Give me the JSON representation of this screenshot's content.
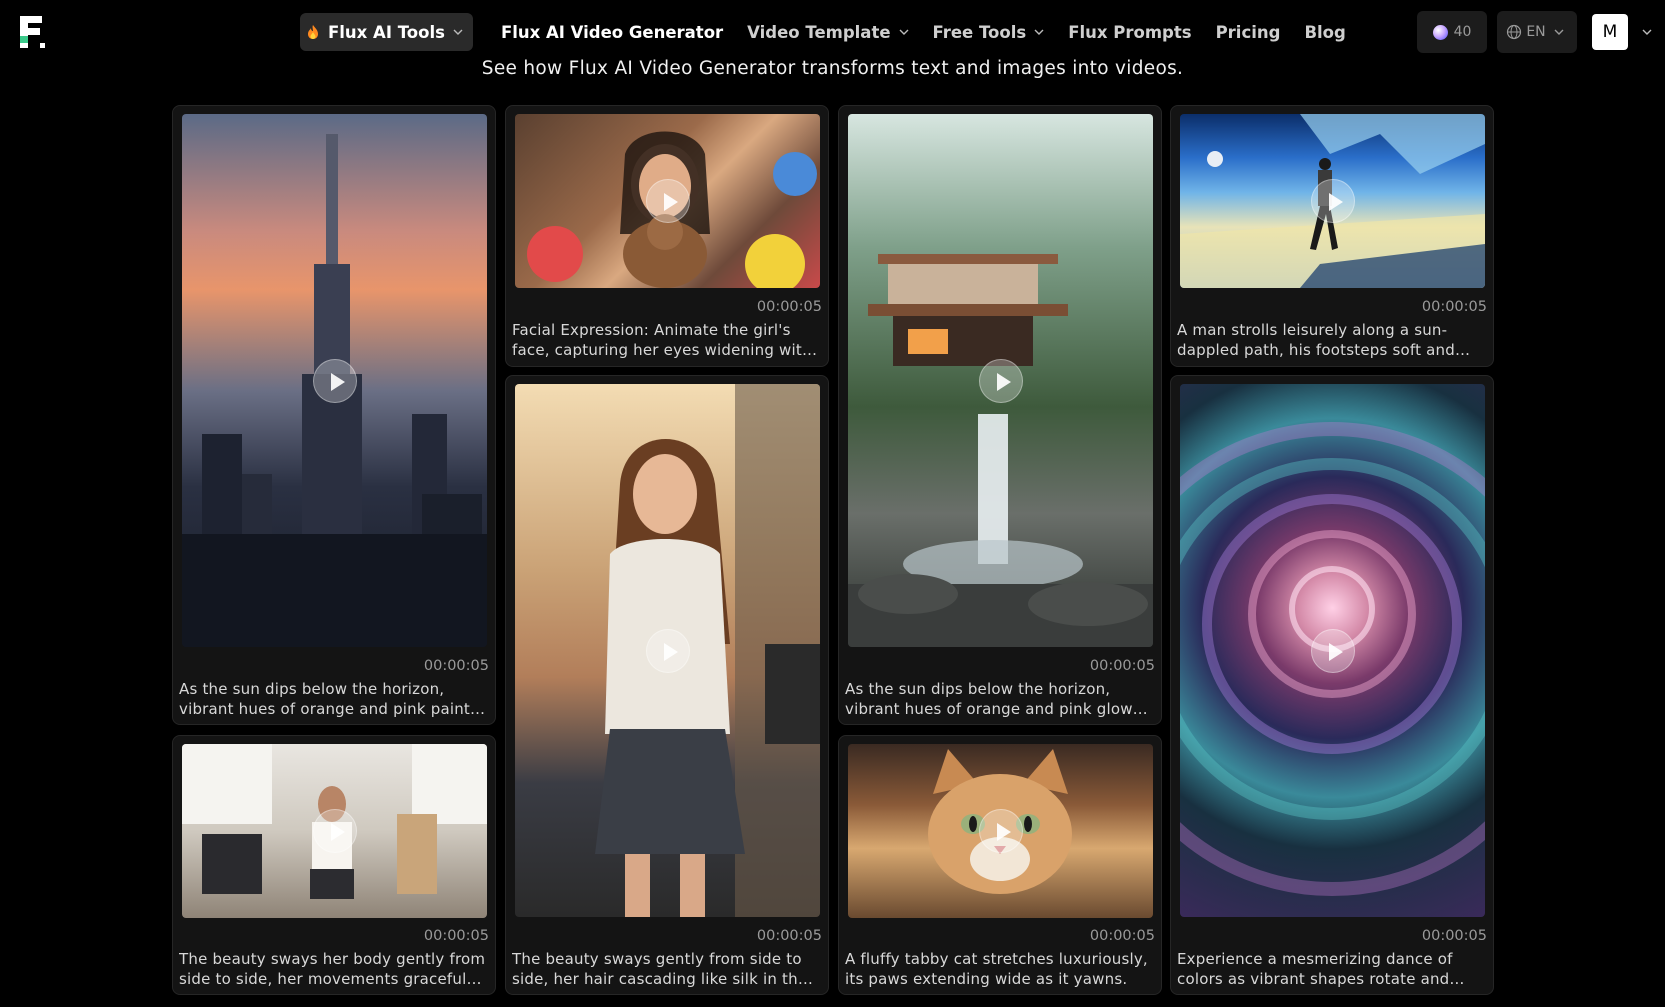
{
  "nav": {
    "tools_label": "Flux AI Tools",
    "links": [
      {
        "label": "Flux AI Video Generator"
      },
      {
        "label": "Video Template"
      },
      {
        "label": "Free Tools"
      },
      {
        "label": "Flux Prompts"
      },
      {
        "label": "Pricing"
      },
      {
        "label": "Blog"
      }
    ],
    "credits": "40",
    "language": "EN",
    "avatar_initial": "M"
  },
  "subtitle": "See how Flux AI Video Generator transforms text and images into videos.",
  "cards": [
    {
      "duration": "00:00:05",
      "caption": "As the sun dips below the horizon, vibrant hues of orange and pink paint the sky over the city skyline."
    },
    {
      "duration": "00:00:05",
      "caption": "Facial Expression: Animate the girl's face, capturing her eyes widening with delight."
    },
    {
      "duration": "00:00:05",
      "caption": "As the sun dips below the horizon, vibrant hues of orange and pink glow over the waterfall."
    },
    {
      "duration": "00:00:05",
      "caption": "A man strolls leisurely along a sun-dappled path, his footsteps soft and steady."
    },
    {
      "duration": "00:00:05",
      "caption": "The beauty sways her body gently from side to side, her movements graceful and slow."
    },
    {
      "duration": "00:00:05",
      "caption": "The beauty sways gently from side to side, her hair cascading like silk in the light."
    },
    {
      "duration": "00:00:05",
      "caption": "A fluffy tabby cat stretches luxuriously, its paws extending wide as it yawns."
    },
    {
      "duration": "00:00:05",
      "caption": "Experience a mesmerizing dance of colors as vibrant shapes rotate and swirl endlessly."
    }
  ]
}
